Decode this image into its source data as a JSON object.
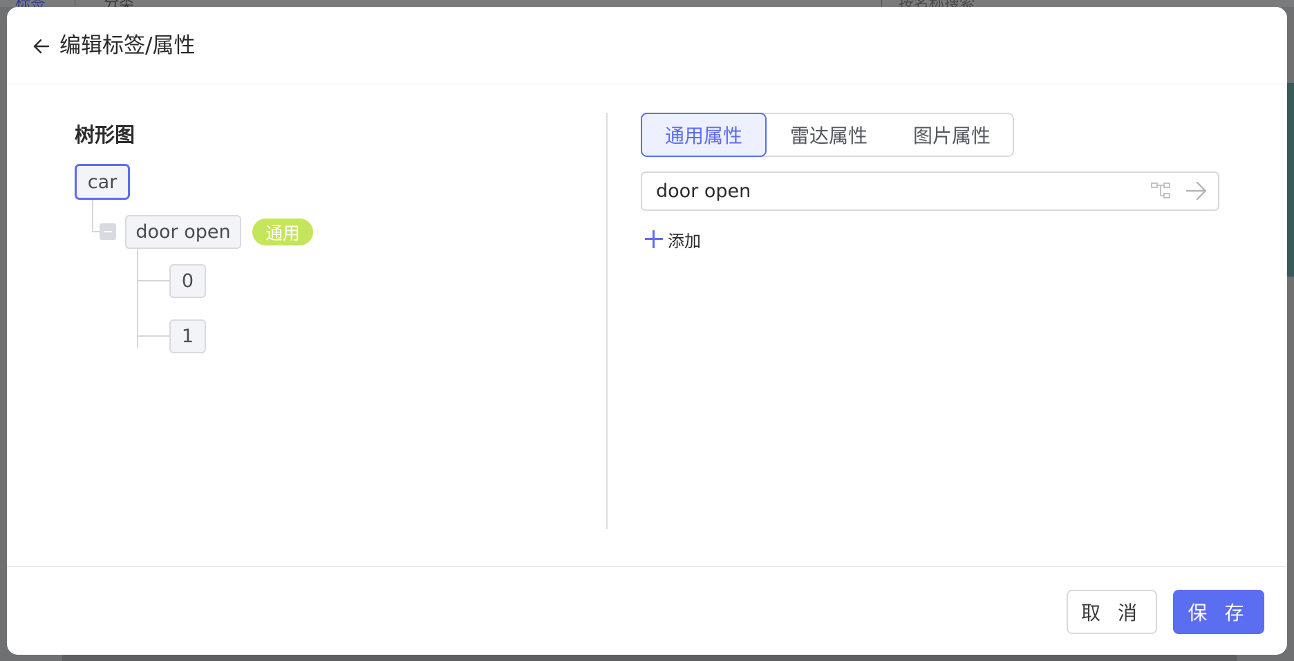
{
  "background": {
    "tab_1": "标签",
    "tab_2": "分类",
    "search_placeholder": "按名称搜索"
  },
  "modal": {
    "title": "编辑标签/属性",
    "back_icon": "arrow-left-icon"
  },
  "tree": {
    "heading": "树形图",
    "root": "car",
    "child": "door open",
    "child_badge": "通用",
    "leaves": [
      "0",
      "1"
    ],
    "collapse_icon": "minus-icon"
  },
  "attributes": {
    "tabs": [
      {
        "label": "通用属性",
        "active": true
      },
      {
        "label": "雷达属性",
        "active": false
      },
      {
        "label": "图片属性",
        "active": false
      }
    ],
    "input_value": "door open",
    "add_label": "添加"
  },
  "footer": {
    "cancel_label": "取 消",
    "save_label": "保 存"
  },
  "colors": {
    "accent": "#5b6df0",
    "badge": "#c5e55a",
    "node_bg": "#f3f4f7",
    "node_border": "#d9dadf"
  }
}
